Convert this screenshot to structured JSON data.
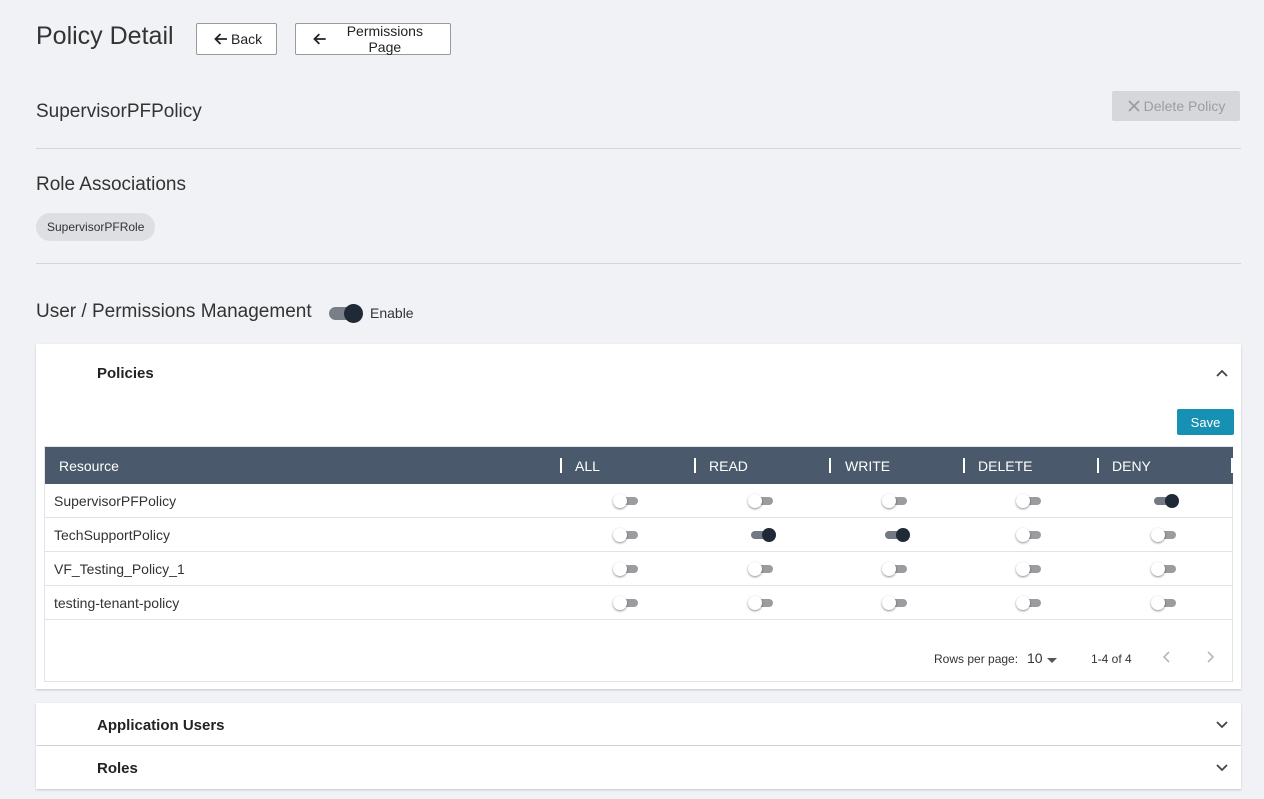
{
  "header": {
    "title": "Policy Detail",
    "back_label": "Back",
    "permissions_label": "Permissions Page"
  },
  "policy": {
    "name": "SupervisorPFPolicy",
    "delete_label": "Delete Policy"
  },
  "role_associations": {
    "title": "Role Associations",
    "roles": [
      "SupervisorPFRole"
    ]
  },
  "user_permissions": {
    "title": "User / Permissions Management",
    "toggle_label": "Enable",
    "enabled": true
  },
  "policies_panel": {
    "title": "Policies",
    "save_label": "Save",
    "columns": [
      "Resource",
      "ALL",
      "READ",
      "WRITE",
      "DELETE",
      "DENY"
    ],
    "rows": [
      {
        "resource": "SupervisorPFPolicy",
        "all": false,
        "read": false,
        "write": false,
        "delete": false,
        "deny": true
      },
      {
        "resource": "TechSupportPolicy",
        "all": false,
        "read": true,
        "write": true,
        "delete": false,
        "deny": false
      },
      {
        "resource": "VF_Testing_Policy_1",
        "all": false,
        "read": false,
        "write": false,
        "delete": false,
        "deny": false
      },
      {
        "resource": "testing-tenant-policy",
        "all": false,
        "read": false,
        "write": false,
        "delete": false,
        "deny": false
      }
    ],
    "pagination": {
      "rows_per_page_label": "Rows per page:",
      "rows_per_page": "10",
      "range": "1-4 of 4"
    }
  },
  "other_panels": {
    "application_users": "Application Users",
    "roles": "Roles"
  },
  "colors": {
    "header_bg": "#4a5a6c",
    "save_bg": "#1791b3",
    "toggle_on": "#1f2a36"
  }
}
